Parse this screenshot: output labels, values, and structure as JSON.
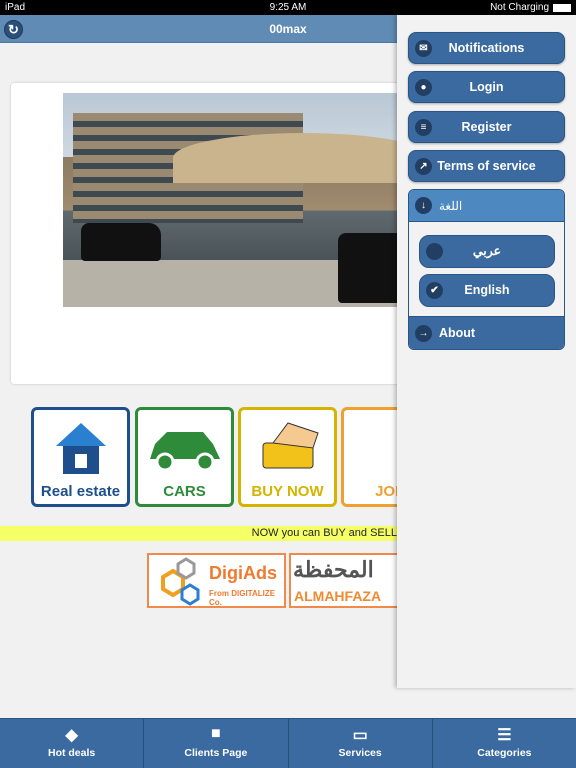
{
  "status_bar": {
    "device": "iPad",
    "time": "9:25 AM",
    "battery": "Not Charging"
  },
  "header": {
    "title": "00max",
    "refresh_icon": "refresh-icon"
  },
  "tiles": [
    {
      "label": "Real estate",
      "color": "#1e4f8c"
    },
    {
      "label": "CARS",
      "color": "#2e8b3a"
    },
    {
      "label": "BUY NOW",
      "color": "#d4b400"
    },
    {
      "label": "JOB",
      "color": "#f0a030"
    }
  ],
  "marquee": "NOW you can BUY and SELL",
  "ads": [
    {
      "name": "DigiAds",
      "sub": "From DIGITALIZE Co."
    },
    {
      "name": "المحفظة",
      "sub": "ALMAHFAZA"
    }
  ],
  "panel": {
    "items": [
      {
        "label": "Notifications",
        "icon": "envelope-icon"
      },
      {
        "label": "Login",
        "icon": "user-icon"
      },
      {
        "label": "Register",
        "icon": "bars-icon"
      },
      {
        "label": "Terms of service",
        "icon": "share-icon"
      }
    ],
    "language": {
      "title": "اللغة",
      "options": [
        {
          "label": "عربي",
          "selected": false
        },
        {
          "label": "English",
          "selected": true
        }
      ]
    },
    "about": "About"
  },
  "tabs": [
    {
      "label": "Hot deals",
      "icon": "fire-icon"
    },
    {
      "label": "Clients Page",
      "icon": "briefcase-icon"
    },
    {
      "label": "Services",
      "icon": "credit-card-icon"
    },
    {
      "label": "Categories",
      "icon": "list-icon"
    }
  ]
}
